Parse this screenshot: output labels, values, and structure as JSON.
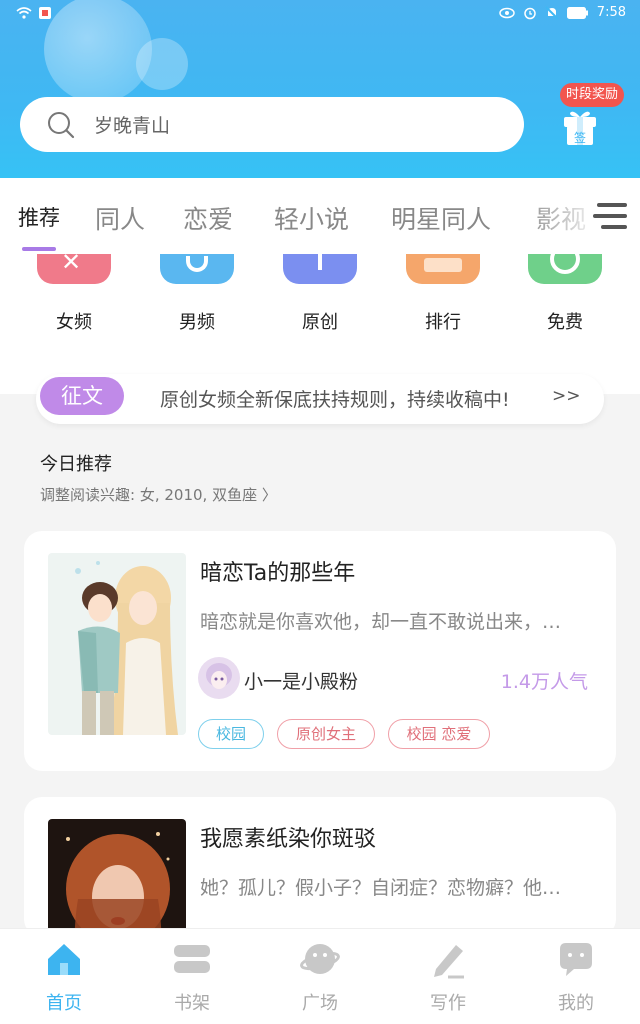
{
  "status_bar": {
    "time": "7:58"
  },
  "search": {
    "placeholder": "岁晚青山"
  },
  "reward": {
    "badge": "时段奖励",
    "sign": "签"
  },
  "tabs": [
    {
      "label": "推荐",
      "active": true
    },
    {
      "label": "同人"
    },
    {
      "label": "恋爱"
    },
    {
      "label": "轻小说"
    },
    {
      "label": "明星同人"
    },
    {
      "label": "影视"
    }
  ],
  "categories": [
    {
      "label": "女频",
      "color": "#f07a8a"
    },
    {
      "label": "男频",
      "color": "#5ab7f0"
    },
    {
      "label": "原创",
      "color": "#7b8ff0"
    },
    {
      "label": "排行",
      "color": "#f5a66b"
    },
    {
      "label": "免费",
      "color": "#6fd08a"
    }
  ],
  "notice": {
    "tag": "征文",
    "text": "原创女频全新保底扶持规则，持续收稿中!",
    "more": ">>"
  },
  "today": {
    "title": "今日推荐",
    "subtitle": "调整阅读兴趣: 女, 2010, 双鱼座 〉"
  },
  "books": [
    {
      "title": "暗恋Ta的那些年",
      "desc": "暗恋就是你喜欢他，却一直不敢说出来，…",
      "author": "小一是小殿粉",
      "popularity": "1.4万人气",
      "tags": [
        "校园",
        "原创女主",
        "校园 恋爱"
      ]
    },
    {
      "title": "我愿素纸染你斑驳",
      "desc": "她？孤儿？假小子？自闭症？恋物癖？他…"
    }
  ],
  "bottom_nav": [
    {
      "label": "首页",
      "icon": "home-icon",
      "active": true
    },
    {
      "label": "书架",
      "icon": "bookshelf-icon"
    },
    {
      "label": "广场",
      "icon": "planet-icon"
    },
    {
      "label": "写作",
      "icon": "pen-icon"
    },
    {
      "label": "我的",
      "icon": "profile-chat-icon"
    }
  ],
  "colors": {
    "accent": "#3db4f0",
    "purple": "#c08ae8",
    "red": "#f2554e"
  }
}
